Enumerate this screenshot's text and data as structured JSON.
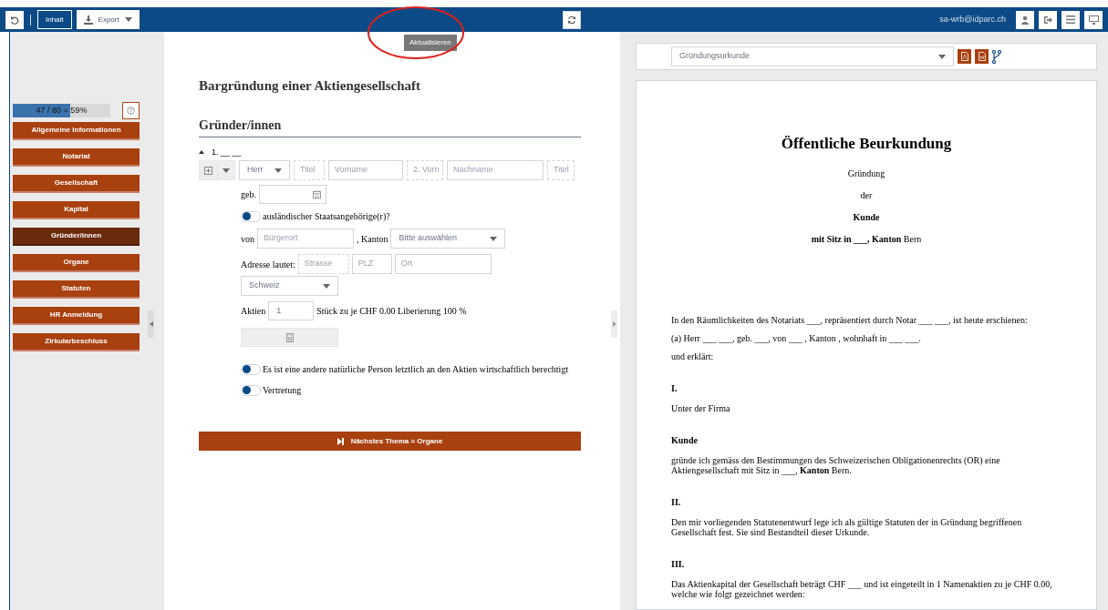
{
  "toolbar": {
    "content_button": "Inhalt",
    "export_button": "Export",
    "tooltip": "Aktualisieren",
    "user": "sa-wrb@idparc.ch"
  },
  "sidebar": {
    "progress": {
      "label": "47 / 80 = 59%",
      "level": 0.59
    },
    "items": [
      {
        "label": "Allgemeine Informationen",
        "selected": false
      },
      {
        "label": "Notariat",
        "selected": false
      },
      {
        "label": "Gesellschaft",
        "selected": false
      },
      {
        "label": "Kapital",
        "selected": false
      },
      {
        "label": "Gründer/innen",
        "selected": true
      },
      {
        "label": "Organe",
        "selected": false
      },
      {
        "label": "Statuten",
        "selected": false
      },
      {
        "label": "HR Anmeldung",
        "selected": false
      },
      {
        "label": "Zirkularbeschluss",
        "selected": false
      }
    ]
  },
  "form": {
    "title": "Bargründung einer Aktiengesellschaft",
    "section": "Gründer/innen",
    "person_header": "1. __ __",
    "salutation": "Herr",
    "name_fields": [
      {
        "placeholder": "Titel",
        "dashed": true
      },
      {
        "placeholder": "Vorname",
        "dashed": false
      },
      {
        "placeholder": "2. Vorn",
        "dashed": true
      },
      {
        "placeholder": "Nachname",
        "dashed": false
      },
      {
        "placeholder": "Titel",
        "dashed": true
      }
    ],
    "born_label": "geb.",
    "foreign_toggle": {
      "label": "ausländischer Staatsangehörige(r)?",
      "on": false
    },
    "from_label": "von",
    "citizen_placeholder": "Bürgerort",
    "canton_label": ", Kanton",
    "canton_select": "Bitte auswählen",
    "address_label": "Adresse lautet:",
    "address_fields": [
      {
        "placeholder": "Strasse",
        "dashed": true
      },
      {
        "placeholder": "PLZ",
        "dashed": false
      },
      {
        "placeholder": "Ort",
        "dashed": false
      }
    ],
    "country_select": "Schweiz",
    "shares_label": "Aktien",
    "shares_value": "1",
    "shares_text": "Stück zu je CHF 0.00 Liberierung 100 %",
    "toggles": [
      {
        "label": "Es ist eine andere natürliche Person letztlich an den Aktien wirtschaftlich berechtigt",
        "on": false
      },
      {
        "label": "Vertretung",
        "on": false
      }
    ],
    "next_button": "Nächstes Thema = Organe"
  },
  "document": {
    "template_select": "Gründungsurkunde",
    "blocks": [
      {
        "kind": "title",
        "text": "Öffentliche Beurkundung"
      },
      {
        "kind": "center",
        "text": "Gründung"
      },
      {
        "kind": "center",
        "text": "der"
      },
      {
        "kind": "center-bold",
        "text": "Kunde"
      },
      {
        "kind": "center",
        "text": "**mit Sitz in ___, Kanton** Bern"
      },
      {
        "kind": "gap"
      },
      {
        "kind": "para",
        "text": "In den Räumlichkeiten des Notariats ___, repräsentiert durch Notar ___ ___, ist heute erschienen:"
      },
      {
        "kind": "para",
        "text": "(a)     Herr ___ ___, geb. ___, von ___ , Kanton , wohnhaft in ___ ___."
      },
      {
        "kind": "para",
        "text": "und erklärt:"
      },
      {
        "kind": "heading",
        "text": "I."
      },
      {
        "kind": "para",
        "text": "Unter der Firma"
      },
      {
        "kind": "heading",
        "text": "Kunde"
      },
      {
        "kind": "para",
        "text": "gründe ich gemäss den Bestimmungen des Schweizerischen Obligationenrechts (OR) eine Aktiengesellschaft mit Sitz in ___, **Kanton** Bern."
      },
      {
        "kind": "heading",
        "text": "II."
      },
      {
        "kind": "para",
        "text": "Den mir vorliegenden Statutenentwurf lege ich als gültige Statuten der in Gründung begriffenen Gesellschaft fest. Sie sind Bestandteil dieser Urkunde."
      },
      {
        "kind": "heading",
        "text": "III."
      },
      {
        "kind": "para",
        "text": "Das Aktienkapital der Gesellschaft beträgt CHF ___ und ist eingeteilt in 1 Namenaktien zu je CHF 0.00, welche wie folgt gezeichnet werden:"
      }
    ]
  }
}
